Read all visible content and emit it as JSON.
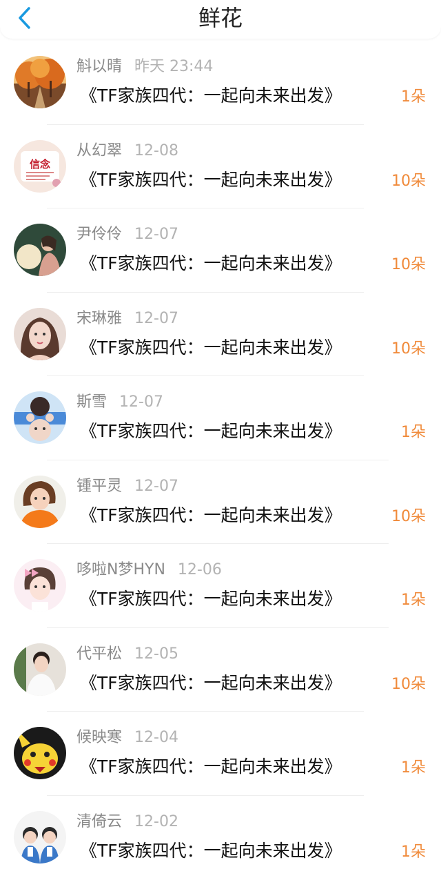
{
  "header": {
    "title": "鲜花",
    "back_icon": "chevron-left-icon",
    "accent_color": "#1a9ae0"
  },
  "colors": {
    "count": "#f08a3a",
    "name": "#8a8a8a",
    "time": "#b3b3b3"
  },
  "items": [
    {
      "name": "斛以晴",
      "time": "昨天 23:44",
      "book": "《TF家族四代：一起向未来出发》",
      "count": "1朵",
      "avatar": "autumn-trees"
    },
    {
      "name": "从幻翠",
      "time": "12-08",
      "book": "《TF家族四代：一起向未来出发》",
      "count": "10朵",
      "avatar": "xinnian-card",
      "avatar_text": "信念"
    },
    {
      "name": "尹伶伶",
      "time": "12-07",
      "book": "《TF家族四代：一起向未来出发》",
      "count": "10朵",
      "avatar": "girl-moon"
    },
    {
      "name": "宋琳雅",
      "time": "12-07",
      "book": "《TF家族四代：一起向未来出发》",
      "count": "10朵",
      "avatar": "girl-portrait"
    },
    {
      "name": "斯雪",
      "time": "12-07",
      "book": "《TF家族四代：一起向未来出发》",
      "count": "1朵",
      "avatar": "girl-blue"
    },
    {
      "name": "锺平灵",
      "time": "12-07",
      "book": "《TF家族四代：一起向未来出发》",
      "count": "10朵",
      "avatar": "girl-orange"
    },
    {
      "name": "哆啦N梦HYN",
      "time": "12-06",
      "book": "《TF家族四代：一起向未来出发》",
      "count": "1朵",
      "avatar": "girl-pink-bow"
    },
    {
      "name": "代平松",
      "time": "12-05",
      "book": "《TF家族四代：一起向未来出发》",
      "count": "10朵",
      "avatar": "girl-indoor"
    },
    {
      "name": "候映寒",
      "time": "12-04",
      "book": "《TF家族四代：一起向未来出发》",
      "count": "1朵",
      "avatar": "pikachu"
    },
    {
      "name": "清倚云",
      "time": "12-02",
      "book": "《TF家族四代：一起向未来出发》",
      "count": "1朵",
      "avatar": "two-kids"
    }
  ]
}
